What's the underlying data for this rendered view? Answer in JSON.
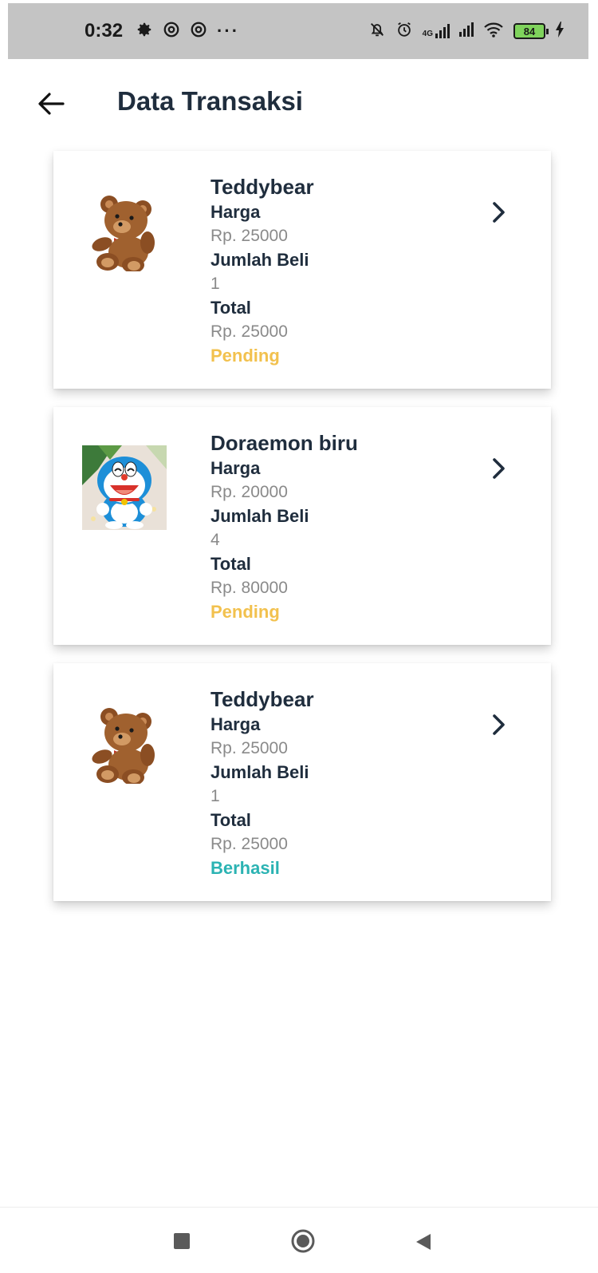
{
  "status_bar": {
    "time": "0:32",
    "dots": "···",
    "battery": "84",
    "network": "4G"
  },
  "header": {
    "title": "Data Transaksi"
  },
  "labels": {
    "price": "Harga",
    "qty": "Jumlah Beli",
    "total": "Total"
  },
  "transactions": [
    {
      "name": "Teddybear",
      "price": "Rp. 25000",
      "qty": "1",
      "total": "Rp. 25000",
      "status": "Pending",
      "image": "teddybear-image"
    },
    {
      "name": "Doraemon biru",
      "price": "Rp. 20000",
      "qty": "4",
      "total": "Rp. 80000",
      "status": "Pending",
      "image": "doraemon-image"
    },
    {
      "name": "Teddybear",
      "price": "Rp. 25000",
      "qty": "1",
      "total": "Rp. 25000",
      "status": "Berhasil",
      "image": "teddybear-image"
    }
  ],
  "colors": {
    "pending": "#f2c14e",
    "success": "#2bb3b3",
    "text_dark": "#1f2d3d",
    "text_muted": "#8a8a8a"
  },
  "icons": {
    "back": "arrow-left-icon",
    "chevron": "chevron-right-icon",
    "nav_recents": "square-icon",
    "nav_home": "circle-icon",
    "nav_back": "triangle-left-icon"
  }
}
